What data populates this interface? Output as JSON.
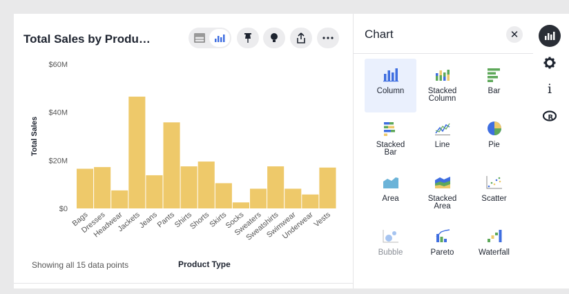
{
  "chart_card": {
    "title": "Total Sales by Produ…",
    "footer": "Showing all 15 data points",
    "toolbar_icons": [
      "table-icon",
      "column-chart-icon",
      "pin-icon",
      "lightbulb-icon",
      "share-icon",
      "more-icon"
    ]
  },
  "chart_data": {
    "type": "bar",
    "categories": [
      "Bags",
      "Dresses",
      "Headwear",
      "Jackets",
      "Jeans",
      "Pants",
      "Shirts",
      "Shorts",
      "Skirts",
      "Socks",
      "Sweaters",
      "Sweatshirts",
      "Swimwear",
      "Underwear",
      "Vests"
    ],
    "values": [
      16.5,
      17.2,
      7.5,
      46.5,
      13.8,
      35.8,
      17.5,
      19.5,
      10.5,
      2.5,
      8.2,
      17.5,
      8.2,
      5.8,
      17.0
    ],
    "xlabel": "Product Type",
    "ylabel": "Total Sales",
    "y_ticks": [
      "$0",
      "$20M",
      "$40M",
      "$60M"
    ],
    "y_tick_values": [
      0,
      20,
      40,
      60
    ],
    "ylim": [
      0,
      60
    ],
    "units": "millions USD",
    "bar_color": "#eec96a",
    "grid": false
  },
  "panel": {
    "title": "Chart",
    "close_icon": "close-icon",
    "chart_types": [
      {
        "label": "Column",
        "icon": "column-icon",
        "selected": true
      },
      {
        "label": "Stacked Column",
        "icon": "stacked-column-icon"
      },
      {
        "label": "Bar",
        "icon": "bar-icon"
      },
      {
        "label": "Stacked Bar",
        "icon": "stacked-bar-icon"
      },
      {
        "label": "Line",
        "icon": "line-icon"
      },
      {
        "label": "Pie",
        "icon": "pie-icon"
      },
      {
        "label": "Area",
        "icon": "area-icon"
      },
      {
        "label": "Stacked Area",
        "icon": "stacked-area-icon"
      },
      {
        "label": "Scatter",
        "icon": "scatter-icon"
      },
      {
        "label": "Bubble",
        "icon": "bubble-icon",
        "disabled": true
      },
      {
        "label": "Pareto",
        "icon": "pareto-icon"
      },
      {
        "label": "Waterfall",
        "icon": "waterfall-icon"
      }
    ]
  },
  "side_toolbar": [
    "chart-settings-icon",
    "gear-icon",
    "info-icon",
    "r-logo-icon"
  ],
  "colors": {
    "accent": "#3f6ee0",
    "bar": "#eec96a",
    "selected_bg": "#eaf0fd"
  }
}
